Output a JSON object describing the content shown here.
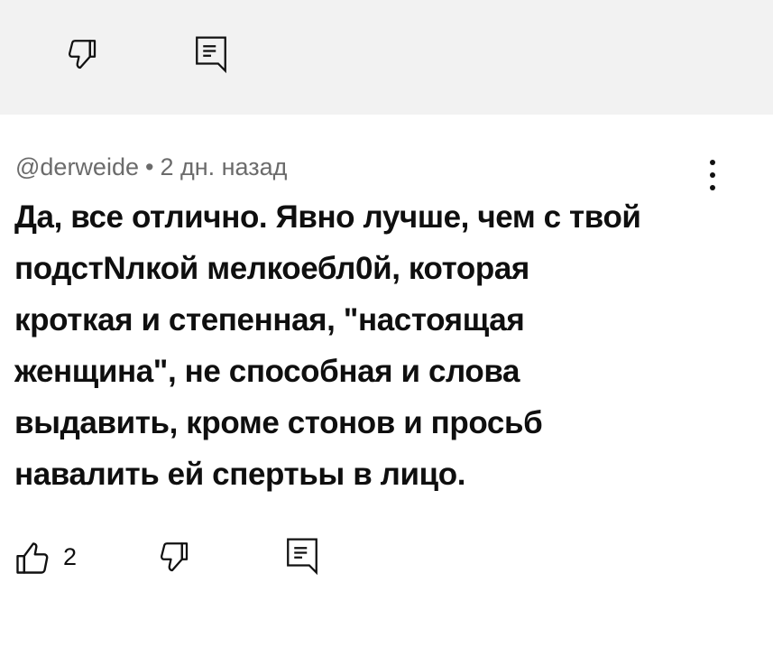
{
  "previous_comment": {
    "actions": {
      "dislike_icon": "thumbs-down-icon",
      "reply_icon": "reply-comment-icon"
    }
  },
  "comment": {
    "author": "@derweide",
    "separator": "•",
    "timestamp": "2 дн. назад",
    "text": "Да, все отлично. Явно лучше, чем с твой\nподстNлкой мелкоебл0й, которая\nкроткая и степенная, \"настоящая\nженщина\", не способная и слова\nвыдавить, кроме стонов и просьб\nнавалить ей спертьы в лицо.",
    "like_count": "2",
    "actions": {
      "like_icon": "thumbs-up-icon",
      "dislike_icon": "thumbs-down-icon",
      "reply_icon": "reply-comment-icon",
      "more_icon": "more-vertical-icon"
    }
  },
  "colors": {
    "background": "#ffffff",
    "top_strip": "#f2f2f2",
    "meta_text": "#6b6b6b",
    "body_text": "#0f0f0f"
  }
}
